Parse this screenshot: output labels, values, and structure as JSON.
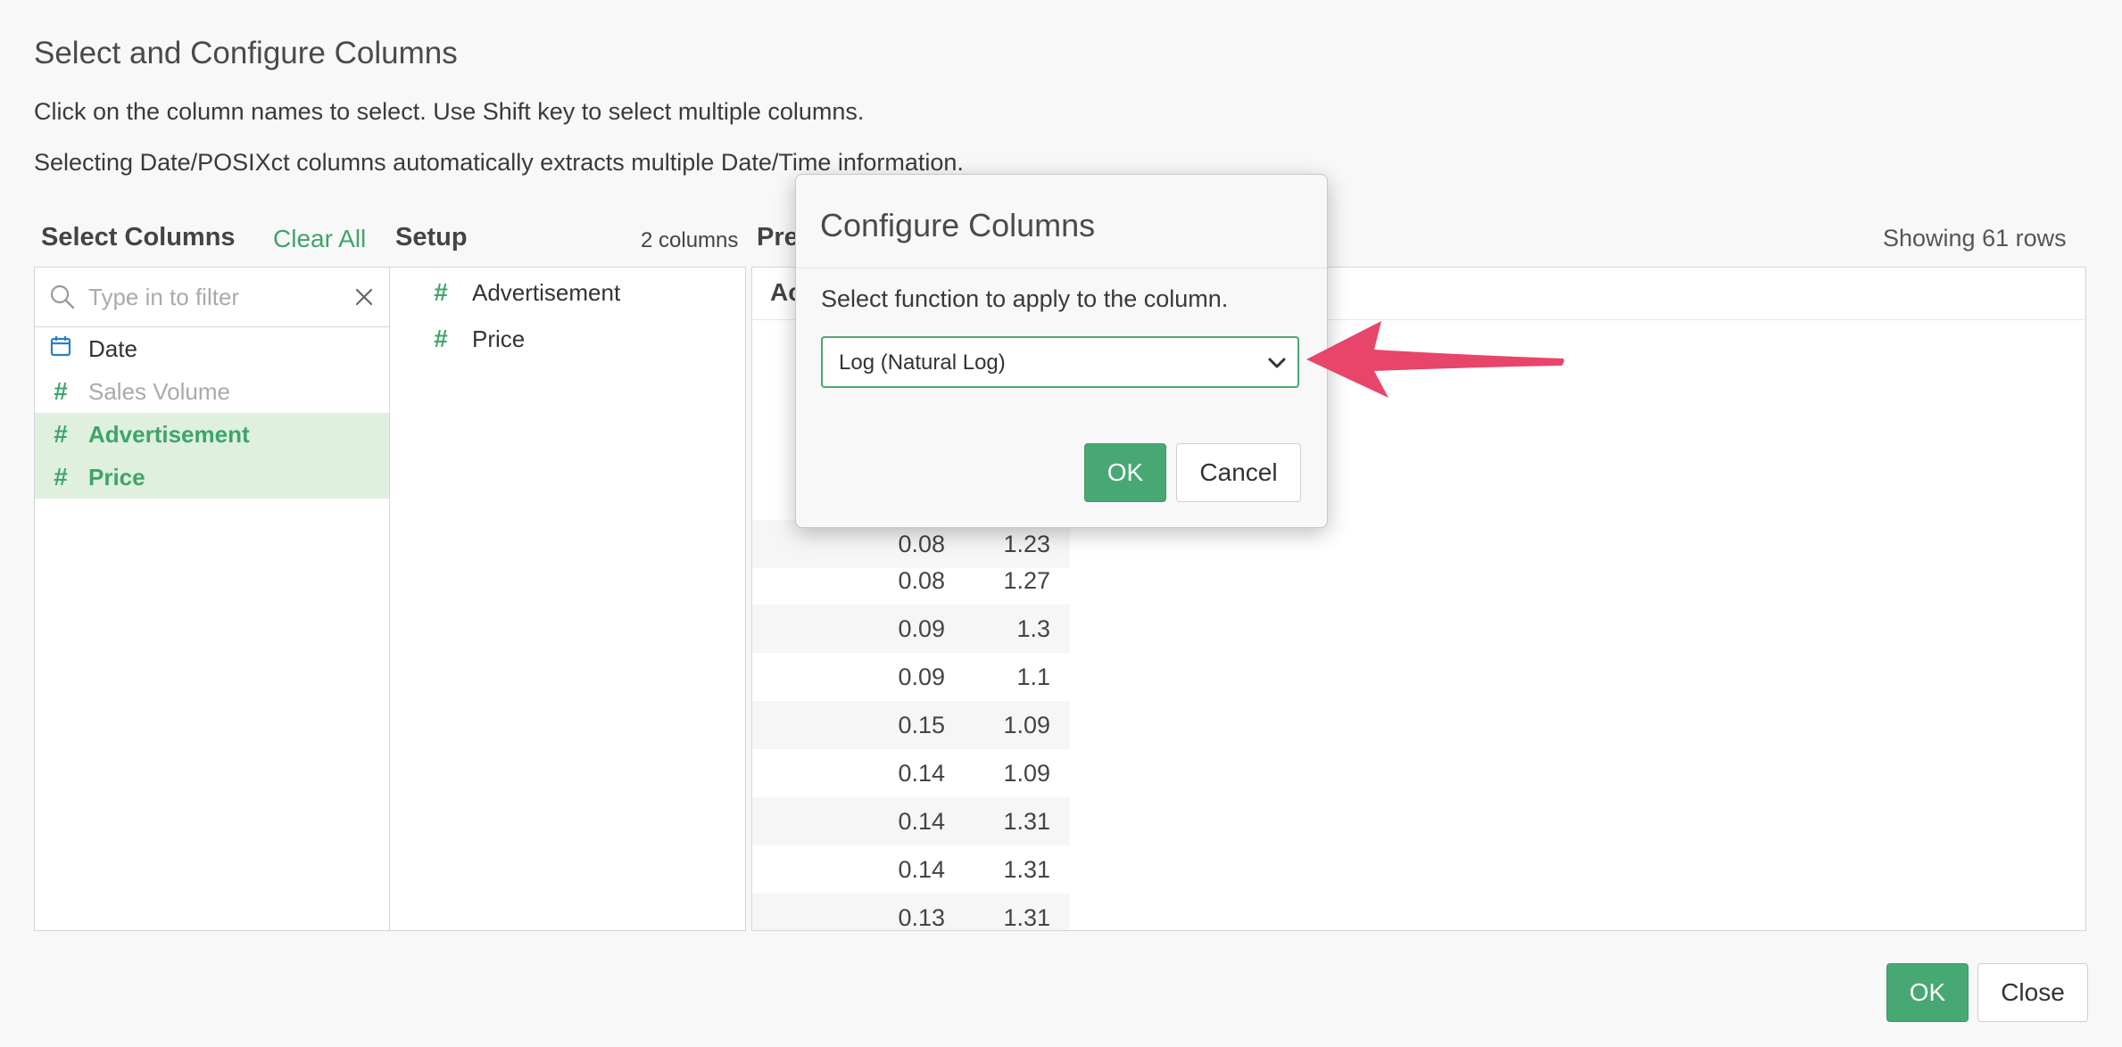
{
  "page": {
    "title": "Select and Configure Columns",
    "desc1": "Click on the column names to select. Use Shift key to select multiple columns.",
    "desc2": "Selecting Date/POSIXct columns automatically extracts multiple Date/Time information."
  },
  "select_panel": {
    "heading": "Select Columns",
    "clear_all": "Clear All",
    "filter_placeholder": "Type in to filter",
    "items": [
      {
        "label": "Date",
        "icon": "calendar-icon",
        "state": "normal"
      },
      {
        "label": "Sales Volume",
        "icon": "hash-icon",
        "state": "disabled"
      },
      {
        "label": "Advertisement",
        "icon": "hash-icon",
        "state": "selected"
      },
      {
        "label": "Price",
        "icon": "hash-icon",
        "state": "selected"
      }
    ]
  },
  "setup_panel": {
    "heading": "Setup",
    "count": "2 columns",
    "items": [
      {
        "label": "Advertisement",
        "icon": "hash-icon"
      },
      {
        "label": "Price",
        "icon": "hash-icon"
      }
    ]
  },
  "preview_panel": {
    "heading": "Pre",
    "col_header": "Ac",
    "showing": "Showing 61 rows",
    "rows": [
      [
        "0.08",
        "1.23"
      ],
      [
        "0.08",
        "1.27"
      ],
      [
        "0.09",
        "1.3"
      ],
      [
        "0.09",
        "1.1"
      ],
      [
        "0.15",
        "1.09"
      ],
      [
        "0.14",
        "1.09"
      ],
      [
        "0.14",
        "1.31"
      ],
      [
        "0.14",
        "1.31"
      ],
      [
        "0.13",
        "1.31"
      ]
    ]
  },
  "modal": {
    "title": "Configure Columns",
    "label": "Select function to apply to the column.",
    "selected_function": "Log (Natural Log)",
    "ok": "OK",
    "cancel": "Cancel"
  },
  "footer": {
    "ok": "OK",
    "close": "Close"
  },
  "colors": {
    "accent": "#48a873",
    "selected_bg": "#dff0df",
    "annotation_arrow": "#e8456b"
  }
}
